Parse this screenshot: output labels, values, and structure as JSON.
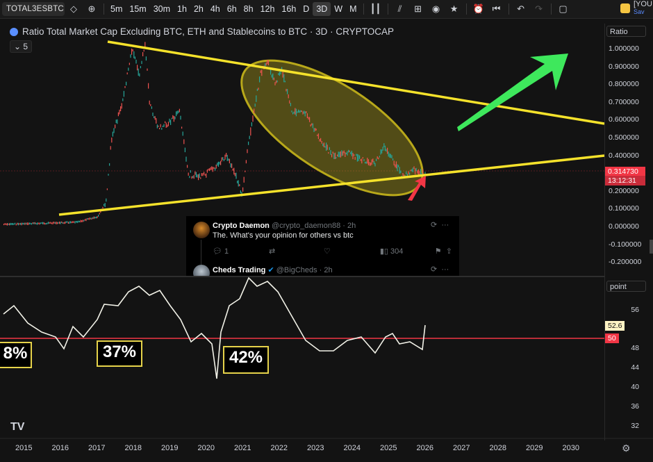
{
  "toolbar": {
    "symbol": "TOTAL3ESBTC",
    "timeframes": [
      "5m",
      "15m",
      "30m",
      "1h",
      "2h",
      "4h",
      "6h",
      "8h",
      "12h",
      "16h",
      "D",
      "3D",
      "W",
      "M"
    ],
    "active_timeframe": "3D",
    "layout_label": "[YOU",
    "save_label": "Sav"
  },
  "chart": {
    "title": "Ratio Total Market Cap Excluding BTC, ETH and Stablecoins to BTC · 3D · CRYPTOCAP",
    "indicator_value": "5",
    "scale_button": "Ratio",
    "price_axis": [
      "1.000000",
      "0.900000",
      "0.800000",
      "0.700000",
      "0.600000",
      "0.500000",
      "0.400000",
      "0.300000",
      "0.200000",
      "0.100000",
      "0.000000",
      "-0.100000",
      "-0.200000"
    ],
    "last_price": "0.314730",
    "countdown": "13:12:31",
    "accent_price_color": "#f23645"
  },
  "indicator_pane": {
    "scale_button": "point",
    "axis": [
      "56",
      "48",
      "44",
      "40",
      "36",
      "32"
    ],
    "current_value": "52.6",
    "level_value": "50",
    "annotations": [
      "8%",
      "37%",
      "42%"
    ]
  },
  "tweet": {
    "name1": "Crypto Daemon",
    "handle1": "@crypto_daemon88 · 2h",
    "text1": "The. What's your opinion for others vs btc",
    "replies": "1",
    "views": "304",
    "name2": "Cheds Trading",
    "handle2": "@BigCheds · 2h"
  },
  "time_axis": [
    "2015",
    "2016",
    "2017",
    "2018",
    "2019",
    "2020",
    "2021",
    "2022",
    "2023",
    "2024",
    "2025",
    "2026",
    "2027",
    "2028",
    "2029",
    "2030"
  ],
  "logo_text": "TV"
}
